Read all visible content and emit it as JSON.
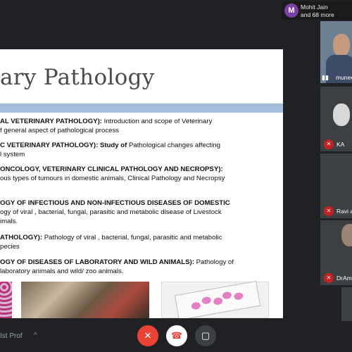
{
  "host": {
    "avatar_initial": "M",
    "name": "Mohit Jain",
    "more": "and 68 more"
  },
  "slide": {
    "title": "ary Pathology",
    "items": [
      {
        "bold": "AL VETERINARY PATHOLOGY):",
        "rest": " Introduction and scope of Veterinary",
        "line2": "f general aspect of pathological process"
      },
      {
        "bold": "C VETERINARY PATHOLOGY): Study of",
        "rest": " Pathological changes affecting",
        "line2": "l system"
      },
      {
        "bold": "ONCOLOGY, VETERINARY CLINICAL PATHOLOGY AND NECROPSY):",
        "rest": "",
        "line2": "ous types of tumours in domestic animals, Clinical Pathology and Necropsy"
      },
      {
        "bold": "OGY OF INFECTIOUS AND NON-INFECTIOUS DISEASES OF DOMESTIC",
        "rest": "",
        "line2": "ogy of viral , bacterial, fungal, parasitic and metabolic disease of Livestock",
        "line3": "imals."
      },
      {
        "bold": "ATHOLOGY):",
        "rest": " Pathology of viral , bacterial, fungal, parasitic and metabolic",
        "line2": "pecies"
      },
      {
        "bold": "OGY OF DISEASES OF LABORATORY AND WILD ANIMALS):",
        "rest": " Pathology of",
        "line2": "laboratory animals and wild/ zoo animals."
      }
    ]
  },
  "participants": [
    {
      "name": "munee"
    },
    {
      "name": "KA"
    },
    {
      "name": "Ravi a"
    },
    {
      "name": "DrAm"
    }
  ],
  "bottom": {
    "meeting_name": "Ist Prof",
    "chevron": "^"
  },
  "colors": {
    "mic_off": "#ea4335",
    "slide_band": "#a6bedb",
    "host_avatar": "#7b3fa6"
  }
}
